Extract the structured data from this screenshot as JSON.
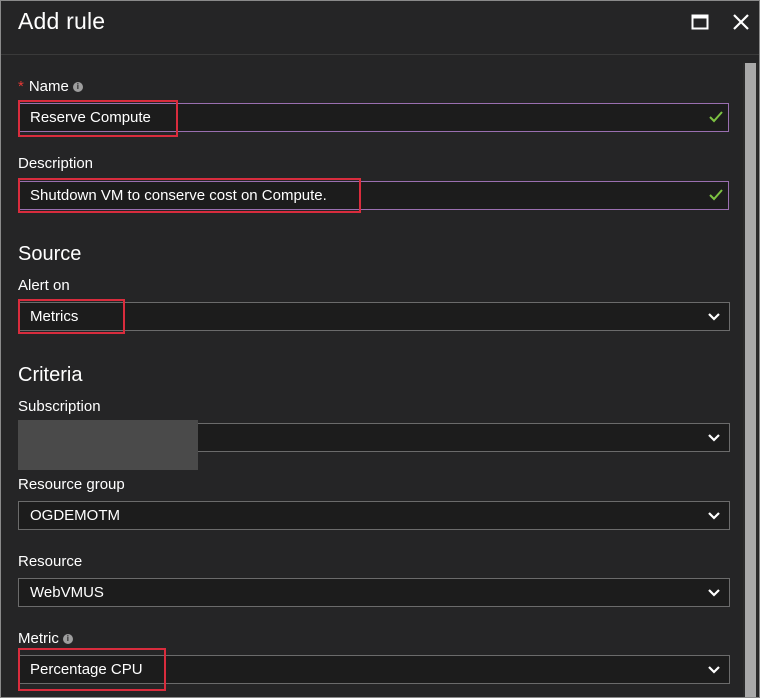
{
  "header": {
    "title": "Add rule",
    "maximize_icon": "maximize-icon",
    "close_icon": "close-icon"
  },
  "fields": {
    "name": {
      "label": "Name",
      "required_marker": "*",
      "info_icon": "i",
      "value": "Reserve Compute",
      "status_icon": "checkmark-icon"
    },
    "description": {
      "label": "Description",
      "value": "Shutdown VM to conserve cost on Compute.",
      "status_icon": "checkmark-icon"
    }
  },
  "source": {
    "section_title": "Source",
    "alert_on": {
      "label": "Alert on",
      "value": "Metrics"
    }
  },
  "criteria": {
    "section_title": "Criteria",
    "subscription": {
      "label": "Subscription",
      "value": ""
    },
    "resource_group": {
      "label": "Resource group",
      "value": "OGDEMOTM"
    },
    "resource": {
      "label": "Resource",
      "value": "WebVMUS"
    },
    "metric": {
      "label": "Metric",
      "info_icon": "i",
      "value": "Percentage CPU"
    }
  },
  "colors": {
    "background": "#252526",
    "input_focus_border": "#9a6fb0",
    "valid_check": "#7dc242",
    "highlight_box": "#d92c3d",
    "required_star": "#e53935"
  }
}
